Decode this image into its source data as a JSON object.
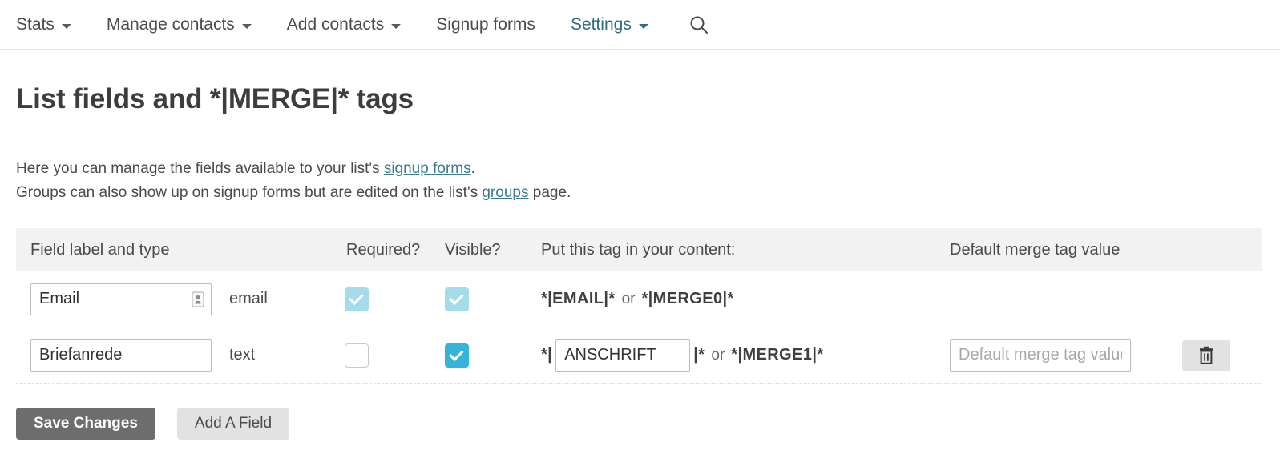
{
  "nav": {
    "items": [
      {
        "label": "Stats",
        "has_caret": true,
        "active": false,
        "name": "nav-stats"
      },
      {
        "label": "Manage contacts",
        "has_caret": true,
        "active": false,
        "name": "nav-manage-contacts"
      },
      {
        "label": "Add contacts",
        "has_caret": true,
        "active": false,
        "name": "nav-add-contacts"
      },
      {
        "label": "Signup forms",
        "has_caret": false,
        "active": false,
        "name": "nav-signup-forms"
      },
      {
        "label": "Settings",
        "has_caret": true,
        "active": true,
        "name": "nav-settings"
      }
    ],
    "search_icon": "search-icon",
    "active_color": "#2a6e84"
  },
  "page": {
    "title": "List fields and *|MERGE|* tags",
    "intro": {
      "line1_before": "Here you can manage the fields available to your list's ",
      "line1_link": "signup forms",
      "line1_after": ".",
      "line2_before": "Groups can also show up on signup forms but are edited on the list's ",
      "line2_link": "groups",
      "line2_after": " page."
    }
  },
  "table": {
    "headers": {
      "label": "Field label and type",
      "required": "Required?",
      "visible": "Visible?",
      "tag": "Put this tag in your content:",
      "default": "Default merge tag value"
    },
    "rows": [
      {
        "label_value": "Email",
        "label_locked": true,
        "lock_icon": "lock-icon",
        "type": "email",
        "required_checked": true,
        "required_disabled": true,
        "visible_checked": true,
        "visible_disabled": true,
        "tag_editable": false,
        "tag_prefix": "*|EMAIL|*",
        "tag_or": "or",
        "tag_alt": "*|MERGE0|*",
        "has_default_input": false,
        "has_delete": false
      },
      {
        "label_value": "Briefanrede",
        "label_locked": false,
        "type": "text",
        "required_checked": false,
        "required_disabled": false,
        "visible_checked": true,
        "visible_disabled": false,
        "tag_editable": true,
        "tag_open": "*|",
        "tag_name_value": "ANSCHRIFT",
        "tag_close": "|*",
        "tag_or": "or",
        "tag_alt": "*|MERGE1|*",
        "has_default_input": true,
        "default_placeholder": "Default merge tag value",
        "default_value": "",
        "has_delete": true,
        "delete_icon": "trash-icon"
      }
    ]
  },
  "footer": {
    "save_label": "Save Changes",
    "add_field_label": "Add A Field"
  },
  "colors": {
    "checkbox_disabled": "#a5dcec",
    "checkbox_active": "#35b4d9",
    "header_bg": "#f2f2f2",
    "primary_button": "#6d6d6d",
    "link": "#3a7b8d"
  }
}
